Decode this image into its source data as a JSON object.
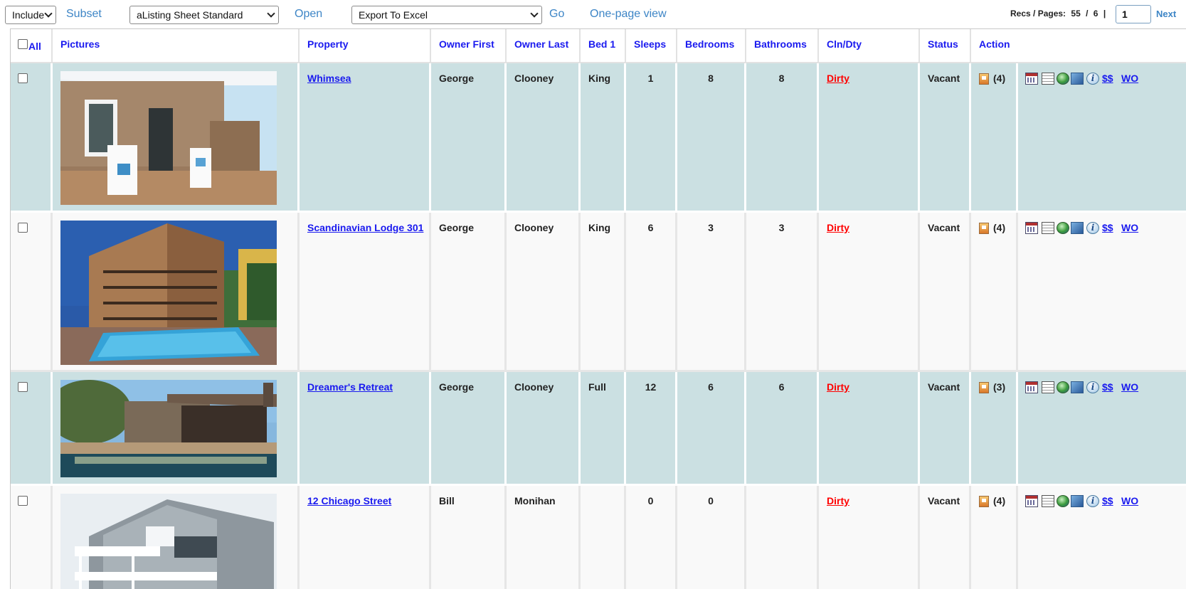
{
  "toolbar": {
    "include_select": "Include",
    "subset_link": "Subset",
    "sheet_select": "aListing Sheet Standard",
    "open_link": "Open",
    "export_select": "Export To Excel",
    "go_link": "Go",
    "onepage_link": "One-page view",
    "recs_label": "Recs / Pages:",
    "recs_count": "55",
    "recs_sep": "/",
    "pages_count": "6",
    "pipe": "|",
    "page_value": "1",
    "next_link": "Next"
  },
  "table": {
    "headers": {
      "all": "All",
      "pictures": "Pictures",
      "property": "Property",
      "owner_first": "Owner First",
      "owner_last": "Owner Last",
      "bed1": "Bed 1",
      "sleeps": "Sleeps",
      "bedrooms": "Bedrooms",
      "bathrooms": "Bathrooms",
      "cln_dty": "Cln/Dty",
      "status": "Status",
      "action": "Action"
    },
    "rows": [
      {
        "property": "Whimsea",
        "owner_first": "George",
        "owner_last": "Clooney",
        "bed1": "King",
        "sleeps": "1",
        "bedrooms": "8",
        "bathrooms": "8",
        "cln_dty": "Dirty",
        "status": "Vacant",
        "pic_count": "(4)",
        "photo_icon": "porch-photo"
      },
      {
        "property": "Scandinavian Lodge 301",
        "owner_first": "George",
        "owner_last": "Clooney",
        "bed1": "King",
        "sleeps": "6",
        "bedrooms": "3",
        "bathrooms": "3",
        "cln_dty": "Dirty",
        "status": "Vacant",
        "pic_count": "(4)",
        "photo_icon": "lodge-photo"
      },
      {
        "property": "Dreamer's Retreat",
        "owner_first": "George",
        "owner_last": "Clooney",
        "bed1": "Full",
        "sleeps": "12",
        "bedrooms": "6",
        "bathrooms": "6",
        "cln_dty": "Dirty",
        "status": "Vacant",
        "pic_count": "(3)",
        "photo_icon": "retreat-photo"
      },
      {
        "property": "12 Chicago Street",
        "owner_first": "Bill",
        "owner_last": "Monihan",
        "bed1": "",
        "sleeps": "0",
        "bedrooms": "0",
        "bathrooms": "",
        "cln_dty": "Dirty",
        "status": "Vacant",
        "pic_count": "(4)",
        "photo_icon": "house-photo"
      }
    ],
    "action_links": {
      "money": "$$",
      "wo": "WO"
    },
    "action_icons": [
      "calendar-icon",
      "sheet-icon",
      "globe-icon",
      "map-icon",
      "info-icon"
    ]
  },
  "colors": {
    "link_blue": "#1a1aef",
    "toolbar_link": "#3d85c6",
    "alt_row": "#cbe0e2",
    "dirty_red": "#ff0000"
  }
}
